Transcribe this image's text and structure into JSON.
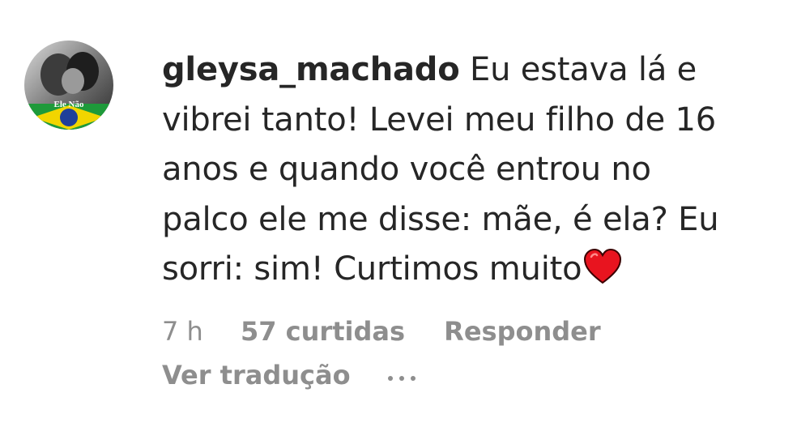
{
  "comment": {
    "avatar": {
      "icon": "profile-avatar",
      "overlay_text": "Ele Não"
    },
    "username": "gleysa_machado",
    "text": "Eu estava lá e vibrei tanto! Levei meu filho de 16 anos e quando você entrou no palco ele me disse: mãe, é ela? Eu sorri: sim! Curtimos muito",
    "emoji": "red-heart-icon",
    "time": "7 h",
    "likes": "57 curtidas",
    "reply_label": "Responder",
    "translate_label": "Ver tradução",
    "more_icon": "more-options-icon"
  },
  "colors": {
    "text": "#262626",
    "muted": "#8e8e8e",
    "heart": "#e8141f",
    "flag_green": "#1e9a3a",
    "flag_yellow": "#f2d500",
    "flag_blue": "#1f3f9a"
  }
}
